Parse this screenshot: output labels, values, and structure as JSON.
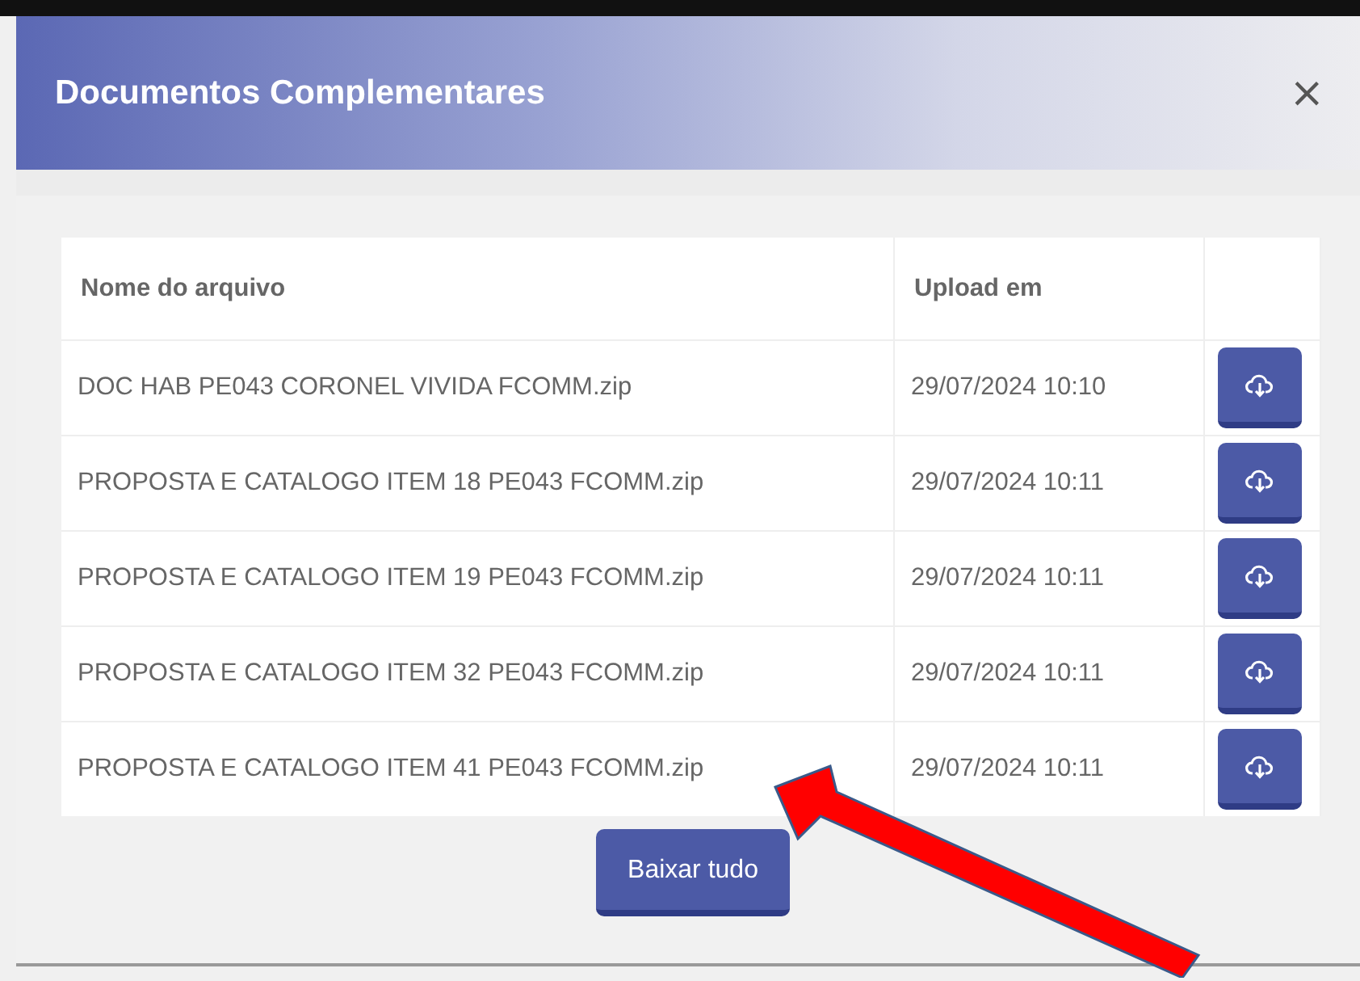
{
  "modal": {
    "title": "Documentos Complementares",
    "close": "×"
  },
  "table": {
    "columns": [
      "Nome do arquivo",
      "Upload em"
    ],
    "rows": [
      {
        "file": "DOC HAB PE043 CORONEL VIVIDA FCOMM.zip",
        "uploaded": "29/07/2024 10:10"
      },
      {
        "file": "PROPOSTA E CATALOGO ITEM 18 PE043 FCOMM.zip",
        "uploaded": "29/07/2024 10:11"
      },
      {
        "file": "PROPOSTA E CATALOGO ITEM 19 PE043 FCOMM.zip",
        "uploaded": "29/07/2024 10:11"
      },
      {
        "file": "PROPOSTA E CATALOGO ITEM 32 PE043 FCOMM.zip",
        "uploaded": "29/07/2024 10:11"
      },
      {
        "file": "PROPOSTA E CATALOGO ITEM 41 PE043 FCOMM.zip",
        "uploaded": "29/07/2024 10:11"
      }
    ]
  },
  "download_all": "Baixar tudo"
}
